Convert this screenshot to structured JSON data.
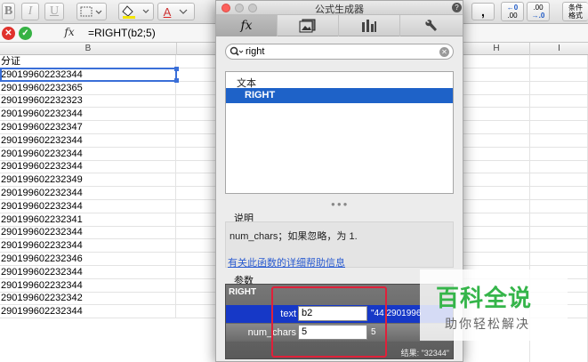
{
  "toolbar": {
    "italic": "I",
    "underline": "U",
    "bold": "B",
    "font_color": "A",
    "comma": ",",
    "inc_dec_top": "←0",
    "inc_dec_bottom": ".00",
    "dec_dec_top": ".00",
    "dec_dec_bottom": "→.0",
    "cond_format_1": "条件",
    "cond_format_2": "格式"
  },
  "formula_bar": {
    "cancel": "✕",
    "confirm": "✓",
    "fx": "fx",
    "formula": "=RIGHT(b2;5)"
  },
  "sheet": {
    "columns": [
      "B",
      "H",
      "I"
    ],
    "rows": [
      "分证",
      "290199602232344",
      "290199602232365",
      "290199602232323",
      "290199602232344",
      "290199602232347",
      "290199602232344",
      "290199602232344",
      "290199602232344",
      "290199602232349",
      "290199602232344",
      "290199602232344",
      "290199602232341",
      "290199602232344",
      "290199602232344",
      "290199602232346",
      "290199602232344",
      "290199602232344",
      "290199602232342",
      "290199602232344"
    ]
  },
  "builder": {
    "title": "公式生成器",
    "help": "?",
    "tabs": [
      "fx",
      "media",
      "chart",
      "tools"
    ],
    "search": {
      "value": "right"
    },
    "category": "文本",
    "selected_function": "RIGHT",
    "description_heading": "说明",
    "description": "num_chars；如果忽略，为 1.",
    "help_link": "有关此函数的详细帮助信息",
    "params_heading": "参数",
    "function_name": "RIGHT",
    "params": [
      {
        "label": "text",
        "value": "b2",
        "result": "\"44 2901996"
      },
      {
        "label": "num_chars",
        "value": "5",
        "result": "5"
      }
    ],
    "result": "结果: \"32344\""
  },
  "watermark": {
    "title": "百科全说",
    "subtitle": "助你轻松解决"
  },
  "colors": {
    "selection": "#1e62c8",
    "param_highlight": "#1638c7",
    "annotation": "#e0203a",
    "watermark_green": "#35b54a"
  }
}
